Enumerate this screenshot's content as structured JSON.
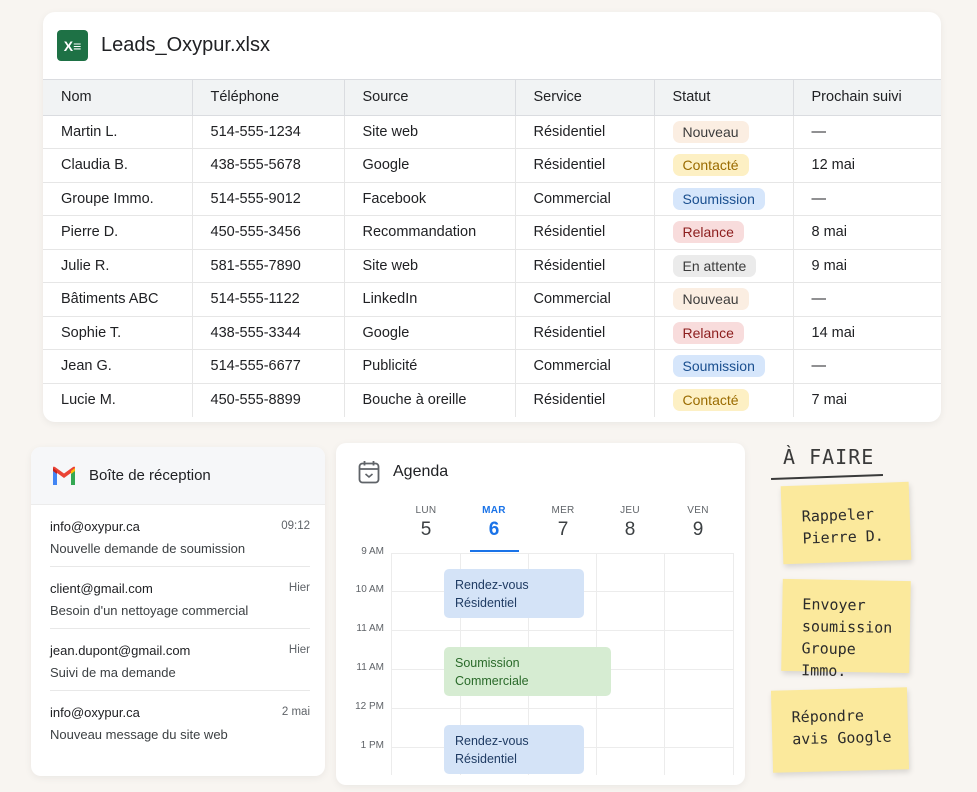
{
  "sheet": {
    "filename": "Leads_Oxypur.xlsx",
    "app_icon": "excel-icon",
    "columns": [
      "Nom",
      "Téléphone",
      "Source",
      "Service",
      "Statut",
      "Prochain suivi"
    ],
    "rows": [
      {
        "nom": "Martin L.",
        "tel": "514-555-1234",
        "source": "Site web",
        "service": "Résidentiel",
        "statut": "Nouveau",
        "suivi": "—"
      },
      {
        "nom": "Claudia B.",
        "tel": "438-555-5678",
        "source": "Google",
        "service": "Résidentiel",
        "statut": "Contacté",
        "suivi": "12 mai"
      },
      {
        "nom": "Groupe Immo.",
        "tel": "514-555-9012",
        "source": "Facebook",
        "service": "Commercial",
        "statut": "Soumission",
        "suivi": "—"
      },
      {
        "nom": "Pierre D.",
        "tel": "450-555-3456",
        "source": "Recommandation",
        "service": "Résidentiel",
        "statut": "Relance",
        "suivi": "8 mai"
      },
      {
        "nom": "Julie R.",
        "tel": "581-555-7890",
        "source": "Site web",
        "service": "Résidentiel",
        "statut": "En attente",
        "suivi": "9 mai"
      },
      {
        "nom": "Bâtiments ABC",
        "tel": "514-555-1122",
        "source": "LinkedIn",
        "service": "Commercial",
        "statut": "Nouveau",
        "suivi": "—"
      },
      {
        "nom": "Sophie T.",
        "tel": "438-555-3344",
        "source": "Google",
        "service": "Résidentiel",
        "statut": "Relance",
        "suivi": "14 mai"
      },
      {
        "nom": "Jean G.",
        "tel": "514-555-6677",
        "source": "Publicité",
        "service": "Commercial",
        "statut": "Soumission",
        "suivi": "—"
      },
      {
        "nom": "Lucie M.",
        "tel": "450-555-8899",
        "source": "Bouche à oreille",
        "service": "Résidentiel",
        "statut": "Contacté",
        "suivi": "7 mai"
      }
    ],
    "status_colors": {
      "Nouveau": {
        "bg": "#fbeee2",
        "fg": "#3c3c3c"
      },
      "Contacté": {
        "bg": "#fdf0c4",
        "fg": "#9a6b00"
      },
      "Soumission": {
        "bg": "#d6e6fb",
        "fg": "#1a4f8f"
      },
      "Relance": {
        "bg": "#f8dcdc",
        "fg": "#8c1d1d"
      },
      "En attente": {
        "bg": "#ebebeb",
        "fg": "#3c3c3c"
      }
    }
  },
  "inbox": {
    "title": "Boîte de réception",
    "icon": "gmail-icon",
    "emails": [
      {
        "from": "info@oxypur.ca",
        "time": "09:12",
        "subject": "Nouvelle demande de soumission"
      },
      {
        "from": "client@gmail.com",
        "time": "Hier",
        "subject": "Besoin d'un nettoyage commercial"
      },
      {
        "from": "jean.dupont@gmail.com",
        "time": "Hier",
        "subject": "Suivi de ma demande"
      },
      {
        "from": "info@oxypur.ca",
        "time": "2 mai",
        "subject": "Nouveau message du site web"
      }
    ]
  },
  "agenda": {
    "title": "Agenda",
    "icon": "calendar-icon",
    "days": [
      {
        "name": "LUN",
        "num": "5",
        "active": false
      },
      {
        "name": "MAR",
        "num": "6",
        "active": true
      },
      {
        "name": "MER",
        "num": "7",
        "active": false
      },
      {
        "name": "JEU",
        "num": "8",
        "active": false
      },
      {
        "name": "VEN",
        "num": "9",
        "active": false
      }
    ],
    "hours": [
      "9 AM",
      "10 AM",
      "11 AM",
      "11 AM",
      "12 PM",
      "1 PM"
    ],
    "events": [
      {
        "line1": "Rendez-vous",
        "line2": "Résidentiel",
        "color": "#d4e3f7",
        "text_color": "#1f3b63"
      },
      {
        "line1": "Soumission",
        "line2": "Commerciale",
        "color": "#d6ecd2",
        "text_color": "#2a6a2a"
      },
      {
        "line1": "Rendez-vous",
        "line2": "Résidentiel",
        "color": "#d4e3f7",
        "text_color": "#1f3b63"
      }
    ]
  },
  "todo": {
    "heading": "À FAIRE",
    "notes": [
      {
        "line1": "Rappeler",
        "line2": "Pierre D.",
        "line3": ""
      },
      {
        "line1": "Envoyer",
        "line2": "soumission",
        "line3": "Groupe Immo."
      },
      {
        "line1": "Répondre",
        "line2": "avis Google",
        "line3": ""
      }
    ]
  }
}
